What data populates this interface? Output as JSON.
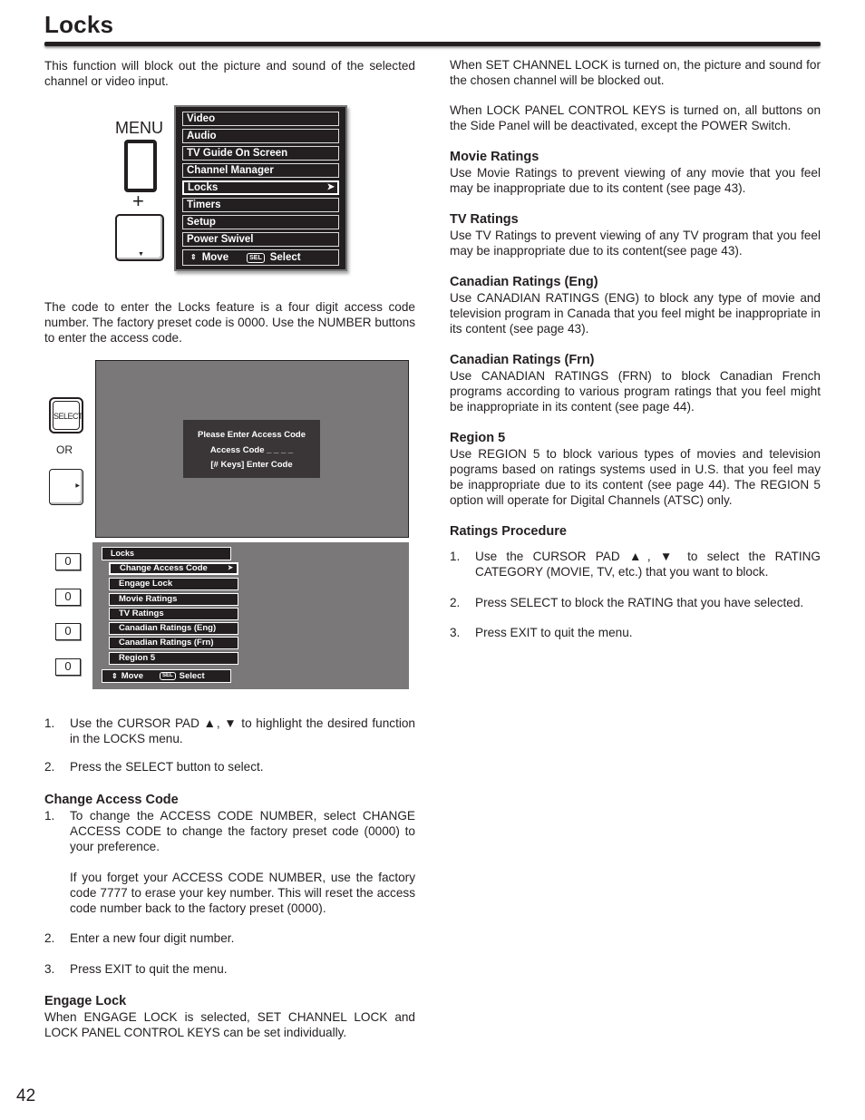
{
  "page": {
    "title": "Locks",
    "page_number": "42"
  },
  "left_column": {
    "intro": "This function will block out the picture and sound of the selected channel or video input.",
    "access_code_text": "The code to enter the Locks feature is a four digit access code number. The factory preset code is 0000. Use the NUMBER buttons to enter the access code.",
    "steps": [
      {
        "num": "1.",
        "text": "Use the CURSOR PAD  ▲, ▼ to highlight the desired function in the LOCKS menu."
      },
      {
        "num": "2.",
        "text": "Press the SELECT button to select."
      }
    ],
    "change_access_code": {
      "heading": "Change Access Code",
      "steps": [
        {
          "num": "1.",
          "text": "To change the ACCESS CODE NUMBER, select CHANGE ACCESS CODE to change the factory preset code (0000) to your preference."
        },
        {
          "num": "",
          "text": "If you forget your ACCESS CODE NUMBER, use the factory code 7777 to erase your key number. This will reset the access code number back to the factory preset (0000)."
        },
        {
          "num": "2.",
          "text": "Enter a new four digit number."
        },
        {
          "num": "3.",
          "text": "Press EXIT to quit the menu."
        }
      ]
    },
    "engage_lock": {
      "heading": "Engage Lock",
      "text": "When ENGAGE LOCK is selected, SET CHANNEL LOCK and LOCK PANEL CONTROL KEYS can be set individually."
    }
  },
  "right_column": {
    "set_channel_lock": "When SET CHANNEL LOCK is turned on, the picture and sound for the chosen channel will be blocked out.",
    "lock_panel": "When LOCK PANEL CONTROL KEYS is turned on, all buttons on the Side Panel will be deactivated, except the POWER Switch.",
    "sections": [
      {
        "heading": "Movie Ratings",
        "text": "Use Movie Ratings to prevent viewing of any movie that you feel may be inappropriate due to its content (see page 43)."
      },
      {
        "heading": "TV Ratings",
        "text": "Use TV Ratings to prevent viewing of any TV program that you feel may be inappropriate due to its content(see page 43)."
      },
      {
        "heading": "Canadian Ratings (Eng)",
        "text": "Use CANADIAN RATINGS (ENG) to block any type of movie and television program in Canada that you feel might be inappropriate in its content (see page 43)."
      },
      {
        "heading": "Canadian Ratings (Frn)",
        "text": "Use CANADIAN RATINGS (FRN) to block Canadian French programs according to various program ratings that you feel might be inappropriate in its content (see page 44)."
      },
      {
        "heading": "Region 5",
        "text": "Use REGION 5 to block various types of movies and television pograms based on ratings systems used in U.S. that you feel may be inappropriate due to its content (see page 44). The REGION 5 option will operate for Digital Channels (ATSC) only."
      }
    ],
    "ratings_procedure": {
      "heading": "Ratings Procedure",
      "steps": [
        {
          "num": "1.",
          "text": "Use the CURSOR PAD ▲, ▼ to select the RATING CATEGORY (MOVIE, TV, etc.) that you want to block."
        },
        {
          "num": "2.",
          "text": "Press SELECT to block the RATING that you have selected."
        },
        {
          "num": "3.",
          "text": "Press EXIT to quit the menu."
        }
      ]
    }
  },
  "diagram_main_menu": {
    "menu_label": "MENU",
    "plus": "+",
    "items": [
      "Video",
      "Audio",
      "TV Guide On Screen",
      "Channel Manager",
      "Locks",
      "Timers",
      "Setup",
      "Power Swivel"
    ],
    "selected_index": 4,
    "footer_move": "Move",
    "footer_sel": "SEL",
    "footer_select": "Select",
    "arrow": "➤"
  },
  "diagram_access": {
    "select_key": "SELECT",
    "or": "OR",
    "dialog_line1": "Please Enter Access Code",
    "dialog_line2": "Access Code  _ _ _ _",
    "dialog_line3": "[# Keys] Enter Code"
  },
  "diagram_locks_menu": {
    "digits": [
      "0",
      "0",
      "0",
      "0"
    ],
    "title": "Locks",
    "items": [
      "Change Access Code",
      "Engage Lock",
      "Movie Ratings",
      "TV Ratings",
      "Canadian Ratings (Eng)",
      "Canadian Ratings (Frn)",
      "Region 5"
    ],
    "selected_index": 0,
    "footer_move": "Move",
    "footer_sel": "SEL",
    "footer_select": "Select"
  }
}
